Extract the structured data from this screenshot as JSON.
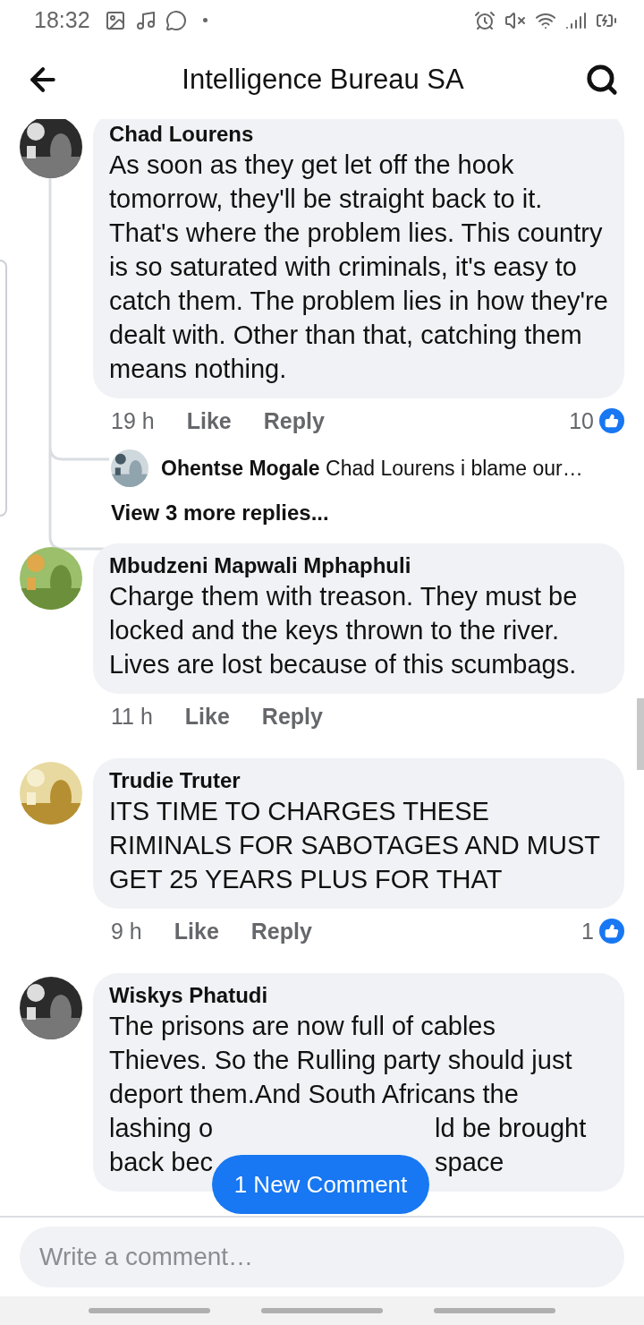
{
  "status_bar": {
    "time": "18:32"
  },
  "app_bar": {
    "title": "Intelligence Bureau SA"
  },
  "comments": [
    {
      "author": "Chad Lourens",
      "text": "As soon as they get let off the hook tomorrow, they'll be straight back to it. That's where the problem lies. This country is so saturated with criminals, it's easy to catch them. The problem lies in how they're dealt with. Other than that, catching them means nothing.",
      "time": "19 h",
      "like": "Like",
      "reply": "Reply",
      "reactions": "10",
      "replies": [
        {
          "author": "Ohentse Mogale",
          "text": "Chad Lourens i blame our…"
        }
      ],
      "more_replies": "View 3 more replies..."
    },
    {
      "author": "Mbudzeni Mapwali Mphaphuli",
      "text": "Charge them with treason. They must be locked and the keys thrown to the river. Lives are lost because of this scumbags.",
      "time": "11 h",
      "like": "Like",
      "reply": "Reply"
    },
    {
      "author": "Trudie Truter",
      "text": "ITS TIME TO CHARGES THESE RIMINALS FOR SABOTAGES AND MUST GET 25 YEARS PLUS FOR THAT",
      "time": "9 h",
      "like": "Like",
      "reply": "Reply",
      "reactions": "1"
    },
    {
      "author": "Wiskys Phatudi",
      "lines": [
        [
          "The prisons are now full of cables"
        ],
        [
          "Thieves. So the Rulling party should just"
        ],
        [
          "deport them.And South Africans the"
        ],
        [
          "lashing o",
          "ld be brought"
        ],
        [
          "back bec",
          "space"
        ]
      ]
    }
  ],
  "new_comment_button": "1 New Comment",
  "composer": {
    "placeholder": "Write a comment…"
  }
}
